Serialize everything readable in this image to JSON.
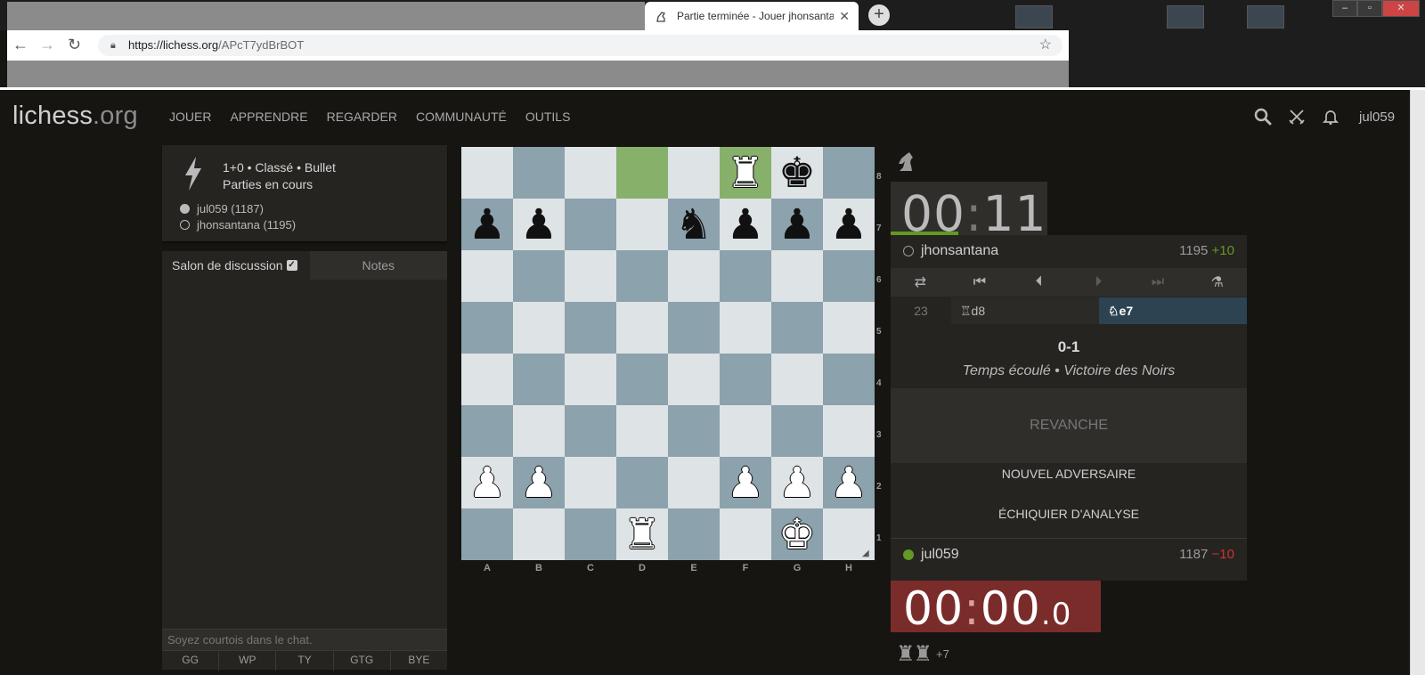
{
  "browser": {
    "tab_title": "Partie terminée - Jouer jhonsantana",
    "tab_close": "✕",
    "new_tab": "+",
    "url_host": "https://lichess.org",
    "url_path": "/APcT7ydBrBOT"
  },
  "header": {
    "logo_main": "lichess",
    "logo_tld": ".org",
    "nav": [
      "JOUER",
      "APPRENDRE",
      "REGARDER",
      "COMMUNAUTÉ",
      "OUTILS"
    ],
    "username": "jul059"
  },
  "game_info": {
    "setup": "1+0 • Classé • Bullet",
    "status": "Parties en cours",
    "white_player": "jul059 (1187)",
    "black_player": "jhonsantana (1195)"
  },
  "chat": {
    "tab_chat": "Salon de discussion",
    "tab_notes": "Notes",
    "placeholder": "Soyez courtois dans le chat.",
    "presets": [
      "GG",
      "WP",
      "TY",
      "GTG",
      "BYE"
    ]
  },
  "board": {
    "files": [
      "A",
      "B",
      "C",
      "D",
      "E",
      "F",
      "G",
      "H"
    ],
    "ranks": [
      "8",
      "7",
      "6",
      "5",
      "4",
      "3",
      "2",
      "1"
    ],
    "position": [
      [
        "",
        "",
        "",
        "",
        "",
        "R",
        "k",
        ""
      ],
      [
        "p",
        "p",
        "",
        "",
        "n",
        "p",
        "p",
        "p"
      ],
      [
        "",
        "",
        "",
        "",
        "",
        "",
        "",
        ""
      ],
      [
        "",
        "",
        "",
        "",
        "",
        "",
        "",
        ""
      ],
      [
        "",
        "",
        "",
        "",
        "",
        "",
        "",
        ""
      ],
      [
        "",
        "",
        "",
        "",
        "",
        "",
        "",
        ""
      ],
      [
        "P",
        "P",
        "",
        "",
        "",
        "P",
        "P",
        "P"
      ],
      [
        "",
        "",
        "",
        "R",
        "",
        "",
        "K",
        ""
      ]
    ],
    "last_move": [
      "d8",
      "f8"
    ]
  },
  "opponent": {
    "name": "jhonsantana",
    "rating": "1195",
    "diff": "+10",
    "clock_min": "00",
    "clock_sec": "11"
  },
  "controls": [
    "flip",
    "first",
    "prev",
    "next",
    "last",
    "analysis"
  ],
  "moves": {
    "number": "23",
    "white": "♖d8",
    "black": "♘e7"
  },
  "result": {
    "score": "0-1",
    "status": "Temps écoulé • Victoire des Noirs"
  },
  "buttons": {
    "rematch": "REVANCHE",
    "new_opponent": "NOUVEL ADVERSAIRE",
    "analysis_board": "ÉCHIQUIER D'ANALYSE"
  },
  "me": {
    "name": "jul059",
    "rating": "1187",
    "diff": "−10",
    "clock_min": "00",
    "clock_sec": "00",
    "clock_cs": "0"
  },
  "captured": {
    "pieces": [
      "♜",
      "♜"
    ],
    "material": "+7"
  },
  "colors": {
    "background": "#161512",
    "panel": "#262421",
    "board_light": "#dee3e6",
    "board_dark": "#8ca2ad",
    "last_move": "#9cc27f",
    "positive": "#629924",
    "negative": "#cc3333",
    "clock_expired": "#7a2c2a"
  }
}
